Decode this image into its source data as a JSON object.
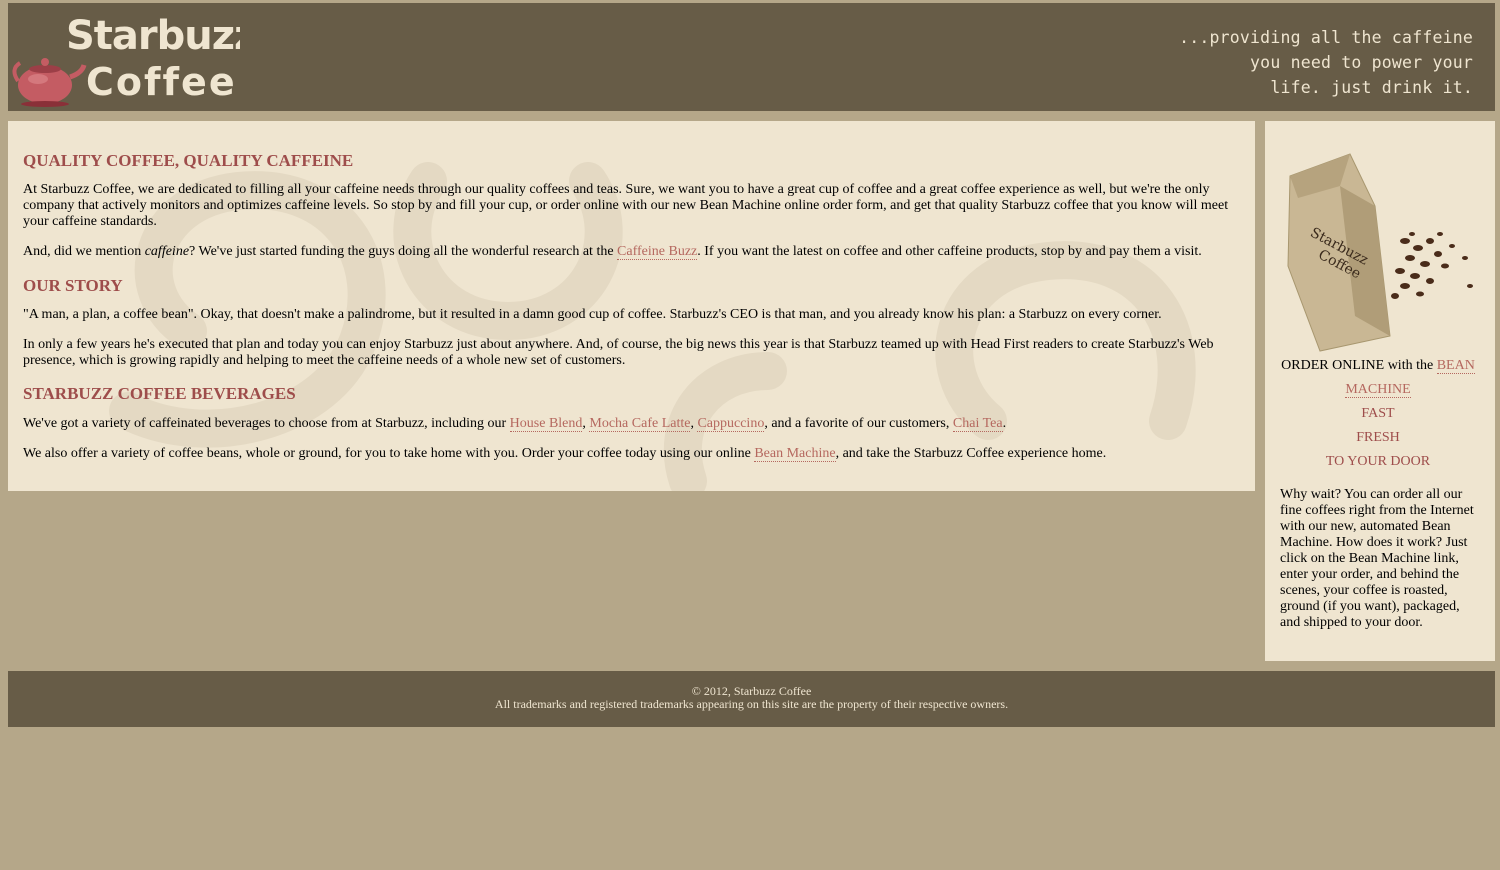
{
  "header": {
    "logo_text": [
      "Starbuzz",
      "Coffee"
    ],
    "slogan": [
      "...providing all the caffeine",
      "you need to power your",
      "life. just drink it."
    ]
  },
  "main": {
    "section1_title": "QUALITY COFFEE, QUALITY CAFFEINE",
    "section1_p1": "At Starbuzz Coffee, we are dedicated to filling all your caffeine needs through our quality coffees and teas. Sure, we want you to have a great cup of coffee and a great coffee experience as well, but we're the only company that actively monitors and optimizes caffeine levels. So stop by and fill your cup, or order online with our new Bean Machine online order form, and get that quality Starbuzz coffee that you know will meet your caffeine standards.",
    "section1_p2_a": "And, did we mention ",
    "section1_p2_em": "caffeine",
    "section1_p2_b": "? We've just started funding the guys doing all the wonderful research at the ",
    "section1_p2_link": "Caffeine Buzz",
    "section1_p2_c": ". If you want the latest on coffee and other caffeine products, stop by and pay them a visit.",
    "section2_title": "OUR STORY",
    "section2_p1": "\"A man, a plan, a coffee bean\". Okay, that doesn't make a palindrome, but it resulted in a damn good cup of coffee. Starbuzz's CEO is that man, and you already know his plan: a Starbuzz on every corner.",
    "section2_p2": "In only a few years he's executed that plan and today you can enjoy Starbuzz just about anywhere. And, of course, the big news this year is that Starbuzz teamed up with Head First readers to create Starbuzz's Web presence, which is growing rapidly and helping to meet the caffeine needs of a whole new set of customers.",
    "section3_title": "STARBUZZ COFFEE BEVERAGES",
    "section3_p1_a": "We've got a variety of caffeinated beverages to choose from at Starbuzz, including our ",
    "links": [
      "House Blend",
      "Mocha Cafe Latte",
      "Cappuccino",
      "Chai Tea"
    ],
    "sep1": ",",
    "sep2": ",",
    "section3_p1_b": ", and a favorite of our customers, ",
    "section3_p1_c": ".",
    "section3_p2_a": "We also offer a variety of coffee beans, whole or ground, for you to take home with you. Order your coffee today using our online ",
    "section3_p2_link": "Bean Machine",
    "section3_p2_b": ", and take the Starbuzz Coffee experience home."
  },
  "sidebar": {
    "bag_text": [
      "Starbuzz",
      "Coffee"
    ],
    "order_prefix": "ORDER ONLINE with the ",
    "order_link_1": "BEAN",
    "order_link_2": "MACHINE",
    "lines": [
      "FAST",
      "FRESH",
      "TO YOUR DOOR"
    ],
    "description": "Why wait? You can order all our fine coffees right from the Internet with our new, automated Bean Machine. How does it work? Just click on the Bean Machine link, enter your order, and behind the scenes, your coffee is roasted, ground (if you want), packaged, and shipped to your door."
  },
  "footer": {
    "copyright": "© 2012, Starbuzz Coffee",
    "trademark": "All trademarks and registered trademarks appearing on this site are the property of their respective owners."
  },
  "colors": {
    "page_bg": "#b5a789",
    "header_bg": "#675c47",
    "panel_bg": "#efe5d0",
    "heading": "#9e4d4b",
    "link": "#b5685f"
  }
}
